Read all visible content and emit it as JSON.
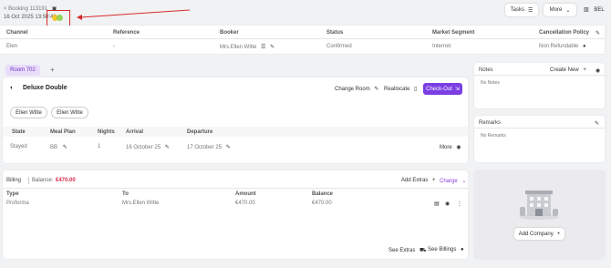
{
  "header": {
    "booking_label": "< Booking 113191",
    "datetime": "16 Oct 2025 13:50:41",
    "tasks_label": "Tasks",
    "more_label": "More",
    "user_code": "BEL"
  },
  "booking_table": {
    "columns": [
      "Channel",
      "Reference",
      "Booker",
      "Status",
      "Market Segment",
      "Cancellation Policy"
    ],
    "row": {
      "channel": "Elen",
      "reference": "-",
      "booker": "Mrs.Ellen Witte",
      "status": "Confirmed",
      "market_segment": "Internet",
      "cancellation_policy": "Non Refundable"
    }
  },
  "room": {
    "tab_label": "Room 702",
    "add_tab": "+",
    "room_type": "Deluxe Double",
    "change_room_label": "Change Room",
    "reallocate_label": "Reallocate",
    "checkout_label": "Check-Out",
    "guests": [
      "Ellen Witte",
      "Ellen Witte"
    ],
    "columns": [
      "State",
      "Meal Plan",
      "Nights",
      "Arrival",
      "Departure"
    ],
    "row": {
      "state": "Stayed",
      "meal_plan": "BB",
      "nights": "1",
      "arrival": "16 October 25",
      "departure": "17 October 25"
    },
    "more_label": "More"
  },
  "billing": {
    "title": "Billing",
    "balance_label": "Balance:",
    "balance_value": "€470.00",
    "add_extras_label": "Add Extras",
    "charge_label": "Charge",
    "columns": [
      "Type",
      "To",
      "Amount",
      "Balance"
    ],
    "row": {
      "type": "Proforma",
      "to": "Mrs.Ellen Witte",
      "amount": "€470.00",
      "balance": "€470.00"
    },
    "see_extras_label": "See Extras",
    "see_billings_label": "See Billings"
  },
  "notes": {
    "title": "Notes",
    "create_label": "Create New",
    "empty": "No Notes"
  },
  "remarks": {
    "title": "Remarks",
    "empty": "No Remarks"
  },
  "company": {
    "add_label": "Add Company"
  },
  "colors": {
    "accent": "#7b3fe4",
    "annotation": "#d62b2b",
    "balance": "#d62b4b",
    "room_tab": "#e9dcfb"
  }
}
